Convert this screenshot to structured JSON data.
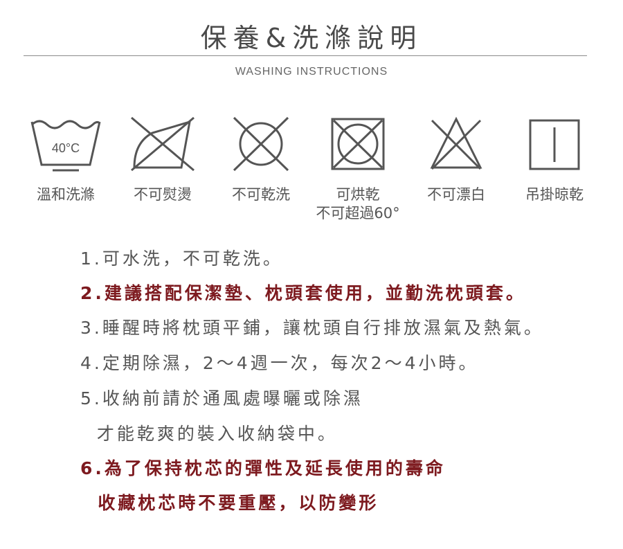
{
  "header": {
    "title": "保養&洗滌說明",
    "subtitle": "WASHING INSTRUCTIONS"
  },
  "care_icons": [
    {
      "icon": "wash-tub-40c-icon",
      "label": "溫和洗滌",
      "temp": "40°C"
    },
    {
      "icon": "no-iron-icon",
      "label": "不可熨燙"
    },
    {
      "icon": "no-dry-clean-icon",
      "label": "不可乾洗"
    },
    {
      "icon": "tumble-dry-icon",
      "label": "可烘乾",
      "label2": "不可超過60°"
    },
    {
      "icon": "no-bleach-icon",
      "label": "不可漂白"
    },
    {
      "icon": "line-dry-icon",
      "label": "吊掛晾乾"
    }
  ],
  "instructions": [
    {
      "text": "1.可水洗，不可乾洗。"
    },
    {
      "text": "2.建議搭配保潔墊、枕頭套使用，並勤洗枕頭套。"
    },
    {
      "text": "3.睡醒時將枕頭平鋪，讓枕頭自行排放濕氣及熱氣。"
    },
    {
      "text": "4.定期除濕，2～4週一次，每次2～4小時。"
    },
    {
      "text": "5.收納前請於通風處曝曬或除濕"
    },
    {
      "text": "  才能乾爽的裝入收納袋中。"
    },
    {
      "text": "6.為了保持枕芯的彈性及延長使用的壽命"
    },
    {
      "text": "  收藏枕芯時不要重壓，以防變形"
    }
  ],
  "colors": {
    "icon_stroke": "#555555",
    "text": "#555555",
    "highlight": "#7d1a1f"
  }
}
